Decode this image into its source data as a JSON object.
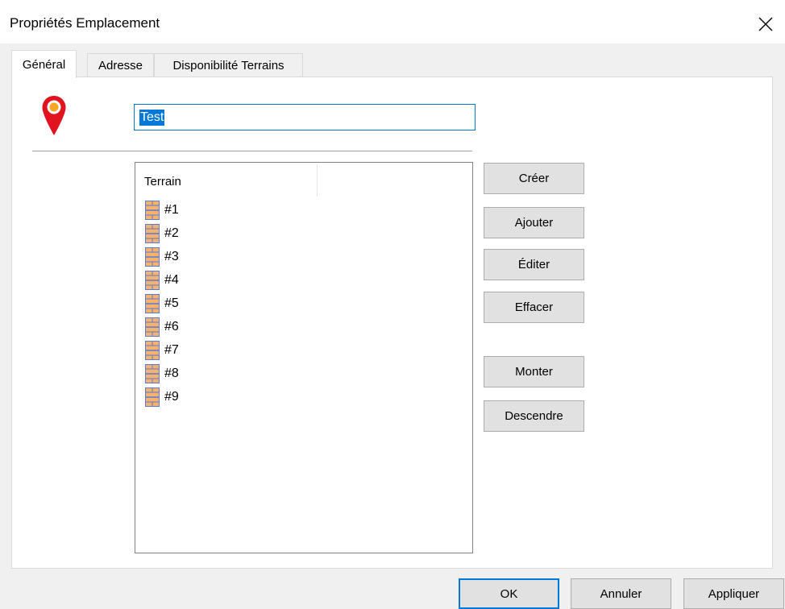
{
  "window": {
    "title": "Propriétés Emplacement",
    "close_icon": "close-icon"
  },
  "tabs": [
    {
      "label": "Général",
      "active": true
    },
    {
      "label": "Adresse",
      "active": false
    },
    {
      "label": "Disponibilité Terrains",
      "active": false
    }
  ],
  "general": {
    "location_icon": "map-pin-icon",
    "name_value": "Test",
    "name_selected": true,
    "list": {
      "column_header": "Terrain",
      "item_icon": "court-icon",
      "items": [
        "#1",
        "#2",
        "#3",
        "#4",
        "#5",
        "#6",
        "#7",
        "#8",
        "#9"
      ]
    },
    "buttons": {
      "create": "Créer",
      "add": "Ajouter",
      "edit": "Éditer",
      "delete": "Effacer",
      "move_up": "Monter",
      "move_down": "Descendre"
    }
  },
  "footer": {
    "ok": "OK",
    "cancel": "Annuler",
    "apply": "Appliquer"
  },
  "colors": {
    "accent": "#0078d7",
    "pin_red": "#e0131f",
    "pin_yellow": "#f5a623",
    "court_fill": "#f6b26b",
    "court_border": "#5b7bd5"
  }
}
